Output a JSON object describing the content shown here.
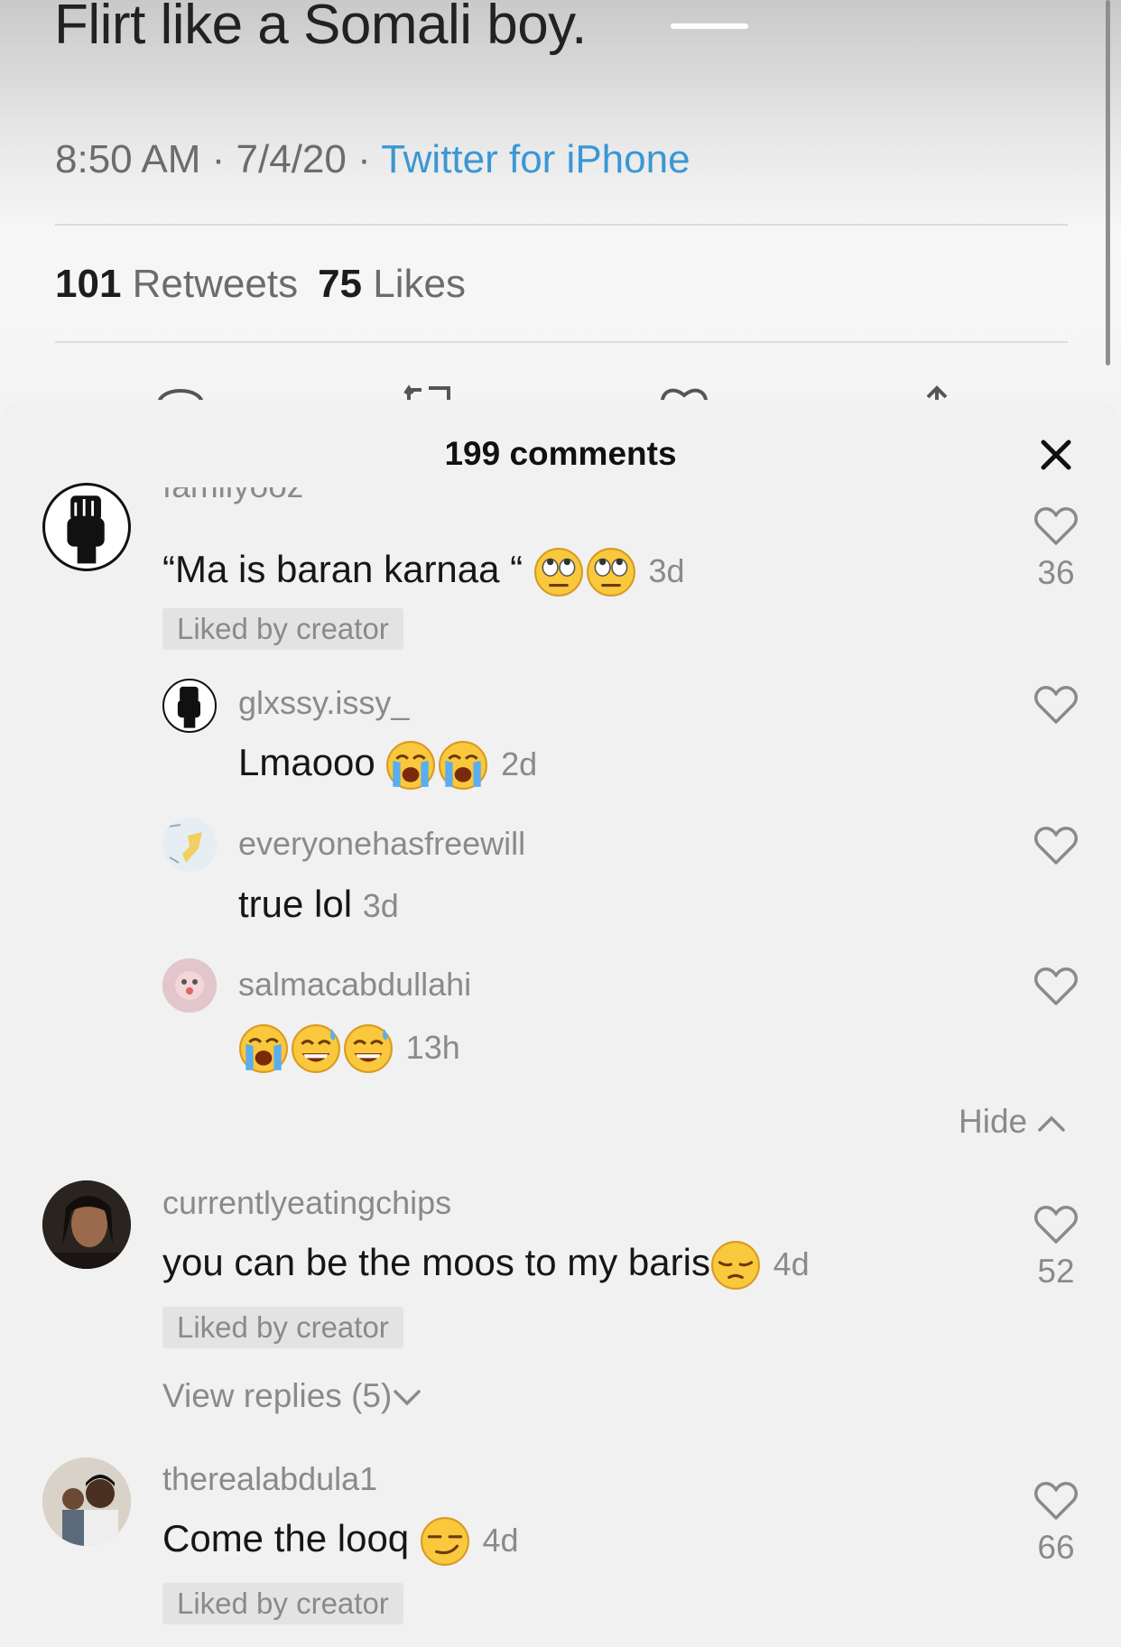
{
  "tweet": {
    "text": "Flirt like a Somali boy.",
    "timestamp": "8:50 AM · 7/4/20 · ",
    "source": "Twitter for iPhone",
    "retweets_count": "101",
    "retweets_label": "Retweets",
    "likes_count": "75",
    "likes_label": "Likes"
  },
  "sheet": {
    "title": "199 comments"
  },
  "comments": [
    {
      "username": "familyooz",
      "text": "“Ma is baran karnaa “",
      "time": "3d",
      "likes": "36",
      "badge": "Liked by creator",
      "replies": [
        {
          "username": "glxssy.issy_",
          "text": "Lmaooo",
          "time": "2d"
        },
        {
          "username": "everyonehasfreewill",
          "text": "true lol",
          "time": "3d"
        },
        {
          "username": "salmacabdullahi",
          "text": "",
          "time": "13h"
        }
      ],
      "hide_label": "Hide"
    },
    {
      "username": "currentlyeatingchips",
      "text": "you can be the moos to my baris",
      "time": "4d",
      "likes": "52",
      "badge": "Liked by creator",
      "view_replies_label": "View replies (5)"
    },
    {
      "username": "therealabdula1",
      "text": "Come the looq",
      "time": "4d",
      "likes": "66",
      "badge": "Liked by creator"
    }
  ],
  "colors": {
    "link_blue": "#3a97d4",
    "muted_gray": "#8a8a8a",
    "badge_bg": "#e3e3e3",
    "sheet_bg": "#f1f1f1"
  },
  "icons": [
    "reply-icon",
    "retweet-icon",
    "heart-icon",
    "share-icon",
    "close-icon",
    "chevron-up-icon",
    "chevron-down-icon",
    "rolling-eyes-emoji",
    "crying-emoji",
    "sweat-smile-emoji",
    "pensive-emoji",
    "smirk-emoji"
  ]
}
